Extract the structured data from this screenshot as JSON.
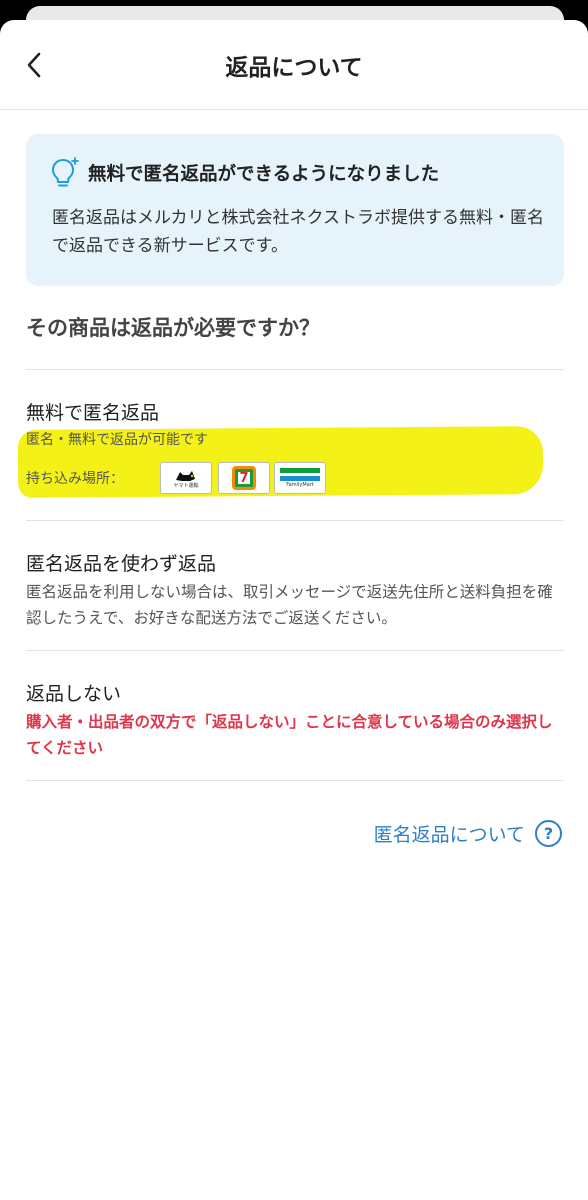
{
  "header": {
    "title": "返品について"
  },
  "info": {
    "title": "無料で匿名返品ができるようになりました",
    "body": "匿名返品はメルカリと株式会社ネクストラボ提供する無料・匿名で返品できる新サービスです。",
    "icon": "lightbulb-icon"
  },
  "question": "その商品は返品が必要ですか？",
  "options": [
    {
      "title": "無料で匿名返品",
      "desc": "匿名・無料で返品が可能です",
      "places_label": "持ち込み場所：",
      "stores": [
        "ヤマト運輸",
        "7",
        "FamilyMart"
      ]
    },
    {
      "title": "匿名返品を使わず返品",
      "desc": "匿名返品を利用しない場合は、取引メッセージで返送先住所と送料負担を確認したうえで、お好きな配送方法でご返送ください。"
    },
    {
      "title": "返品しない",
      "desc": "購入者・出品者の双方で「返品しない」ことに合意している場合のみ選択してください"
    }
  ],
  "help": {
    "label": "匿名返品について",
    "icon_glyph": "?"
  },
  "colors": {
    "accent_blue": "#2f7fc8",
    "warning_red": "#e0354a",
    "info_bg": "#e6f3fb",
    "highlight": "#f3f115"
  }
}
